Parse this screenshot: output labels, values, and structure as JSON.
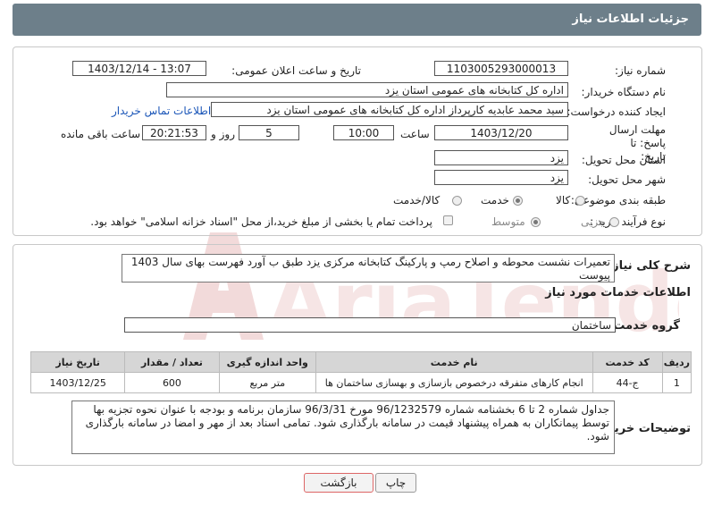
{
  "header": {
    "title": "جزئیات اطلاعات نیاز"
  },
  "fields": {
    "need_number": {
      "label": "شماره نیاز:",
      "value": "1103005293000013"
    },
    "announce_datetime": {
      "label": "تاریخ و ساعت اعلان عمومی:",
      "value": "1403/12/14 - 13:07"
    },
    "buyer_org": {
      "label": "نام دستگاه خریدار:",
      "value": "اداره کل کتابخانه های عمومی استان یزد"
    },
    "requester": {
      "label": "ایجاد کننده درخواست:",
      "value": "سید محمد عابدیه کارپرداز اداره کل کتابخانه های عمومی استان یزد"
    },
    "contact_link": "اطلاعات تماس خریدار",
    "deadline": {
      "label": "مهلت ارسال پاسخ: تا تاریخ:",
      "date": "1403/12/20",
      "time_label": "ساعت",
      "time": "10:00",
      "days": "5",
      "days_label": "روز و",
      "remaining": "20:21:53",
      "remaining_label": "ساعت باقی مانده"
    },
    "province": {
      "label": "استان محل تحویل:",
      "value": "یزد"
    },
    "city": {
      "label": "شهر محل تحویل:",
      "value": "یزد"
    },
    "category": {
      "label": "طبقه بندی موضوعی:",
      "options": [
        "کالا",
        "خدمت",
        "کالا/خدمت"
      ],
      "selected": "خدمت"
    },
    "purchase_type": {
      "label": "نوع فرآیند خرید :",
      "options": [
        "جزیی",
        "متوسط"
      ],
      "selected": "متوسط",
      "note": "پرداخت تمام یا بخشی از مبلغ خرید،از محل \"اسناد خزانه اسلامی\" خواهد بود."
    }
  },
  "summary": {
    "label": "شرح کلی نیاز:",
    "value": "تعمیرات نشست محوطه و اصلاح رمپ و پارکینگ کتابخانه مرکزی یزد طبق ب آورد فهرست بهای سال 1403 پیوست"
  },
  "services": {
    "section_title": "اطلاعات خدمات مورد نیاز",
    "group_label": "گروه خدمت:",
    "group_value": "ساختمان",
    "columns": [
      "ردیف",
      "کد خدمت",
      "نام خدمت",
      "واحد اندازه گیری",
      "تعداد / مقدار",
      "تاریخ نیاز"
    ],
    "rows": [
      [
        "1",
        "ج-44",
        "انجام کارهای متفرقه درخصوص بازسازی و بهسازی ساختمان ها",
        "متر مربع",
        "600",
        "1403/12/25"
      ]
    ]
  },
  "buyer_notes": {
    "label": "توضیحات خریدار:",
    "value": "جداول شماره 2 تا 6 بخشنامه شماره 96/1232579 مورخ 96/3/31 سازمان برنامه و بودجه با عنوان نحوه تجزیه بها توسط پیمانکاران به همراه پیشنهاد قیمت در سامانه بارگذاری شود. تمامی اسناد بعد از مهر و امضا در سامانه بارگذاری شود."
  },
  "buttons": {
    "print": "چاپ",
    "back": "بازگشت"
  },
  "colors": {
    "header": "#6d7f8a",
    "link": "#1b56b8",
    "back_button_border": "#d66"
  }
}
